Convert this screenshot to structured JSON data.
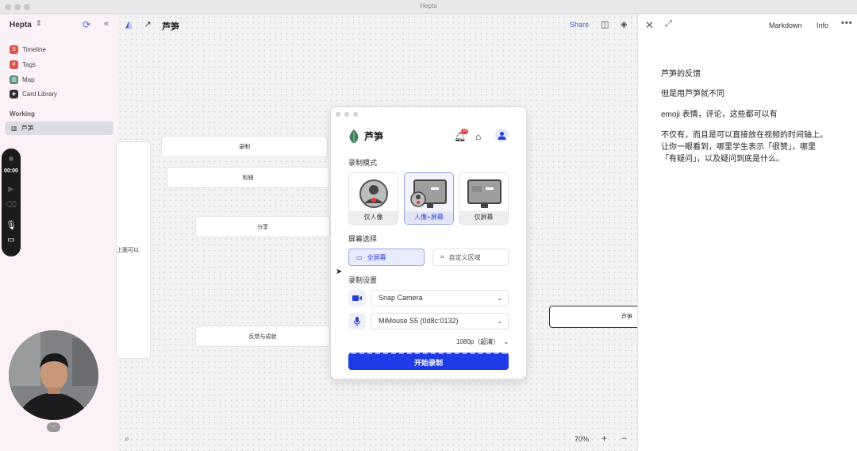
{
  "window": {
    "title": "Hepta"
  },
  "sidebar": {
    "brand": "Hepta",
    "nav": [
      {
        "label": "Timeline",
        "icon": "timeline-icon",
        "color": "#e0534a"
      },
      {
        "label": "Tags",
        "icon": "tag-icon",
        "color": "#d9534f"
      },
      {
        "label": "Map",
        "icon": "map-icon",
        "color": "#5a8f7b"
      },
      {
        "label": "Card Library",
        "icon": "card-library-icon",
        "color": "#2d2d2d"
      }
    ],
    "section_title": "Working",
    "working_items": [
      {
        "label": "芦笋",
        "icon": "map-icon"
      }
    ]
  },
  "recorder": {
    "timer": "00:00"
  },
  "canvas": {
    "title": "芦笋",
    "share": "Share",
    "nodes": [
      "录制",
      "剪辑",
      "分享",
      "反馈与成就",
      "上面可以",
      "芦笋"
    ],
    "zoom": "70%"
  },
  "right_panel": {
    "tabs": [
      "Markdown",
      "Info"
    ],
    "lines": [
      "芦笋的反馈",
      "但是用芦笋就不同",
      "emoji 表情，评论，这些都可以有",
      "不仅有，而且是可以直接放在视频的时间轴上。让你一眼看到，哪里学生表示「很赞」，哪里「有疑问」，以及疑问到底是什么。"
    ]
  },
  "dialog": {
    "brand": "芦笋",
    "notification_count": "10",
    "mode_title": "录制模式",
    "modes": [
      "仅人像",
      "人像+屏幕",
      "仅屏幕"
    ],
    "active_mode": "人像+屏幕",
    "screen_title": "屏幕选择",
    "screen_options": [
      "全屏幕",
      "自定义区域"
    ],
    "settings_title": "录制设置",
    "camera": "Snap Camera",
    "microphone": "MiMouse S5 (0d8c:0132)",
    "quality": "1080p（超清）",
    "start_button": "开始录制",
    "accent_color": "#1f3be8"
  }
}
